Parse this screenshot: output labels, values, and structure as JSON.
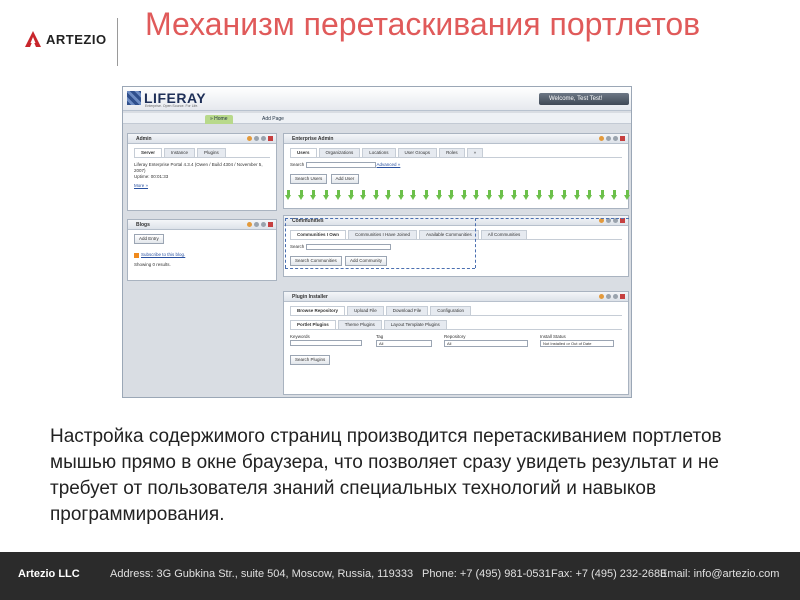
{
  "logo": {
    "text": "ARTEZIO"
  },
  "title": "Механизм перетаскивания портлетов",
  "screenshot": {
    "brand": "LIFERAY",
    "brand_sub": "Enterprise. Open Source. For Life.",
    "welcome": "Welcome, Test Test!",
    "nav": {
      "home": "» Home",
      "add_page": "Add Page"
    },
    "admin_portlet": {
      "title": "Admin",
      "tabs": [
        "Server",
        "Instance",
        "Plugins"
      ],
      "info_1": "Liferay Enterprise Portal 4.3.4 (Owen / Build 4304 / November 5, 2007)",
      "info_2": "Uptime: 00:01:33",
      "link": "More »"
    },
    "blogs_portlet": {
      "title": "Blogs",
      "button": "Add Entry",
      "link": "Subscribe to this blog.",
      "status": "Showing 0 results."
    },
    "enterprise_portlet": {
      "title": "Enterprise Admin",
      "tabs": [
        "Users",
        "Organizations",
        "Locations",
        "User Groups",
        "Roles",
        "»"
      ],
      "search_label": "Search",
      "advanced": "Advanced »",
      "buttons": [
        "Search Users",
        "Add User"
      ]
    },
    "communities_portlet": {
      "title": "Communities",
      "tabs": [
        "Communities I Own",
        "Communities I Have Joined",
        "Available Communities",
        "All Communities"
      ],
      "search_label": "Search",
      "buttons": [
        "Search Communities",
        "Add Community"
      ]
    },
    "plugin_portlet": {
      "title": "Plugin Installer",
      "tabs": [
        "Browse Repository",
        "Upload File",
        "Download File",
        "Configuration"
      ],
      "subtabs": [
        "Portlet Plugins",
        "Theme Plugins",
        "Layout Template Plugins"
      ],
      "labels": [
        "Keywords",
        "Tag",
        "Repository",
        "Install Status"
      ],
      "selects": [
        "All",
        "All",
        "Not Installed or Out of Date"
      ],
      "button": "Search Plugins"
    }
  },
  "description": "Настройка содержимого страниц производится перетаскиванием портлетов мышью прямо в окне браузера, что позволяет сразу увидеть результат и не требует от пользователя знаний специальных технологий и навыков программирования.",
  "footer": {
    "company": "Artezio LLC",
    "address": "Address: 3G Gubkina Str., suite 504, Moscow, Russia, 119333",
    "phone": "Phone: +7 (495) 981-0531",
    "fax": "Fax: +7 (495) 232-2683",
    "email": "Email: info@artezio.com"
  },
  "colors": {
    "title": "#e05a5a",
    "footer_bg": "#2b2b2b",
    "logo_red": "#c8262c"
  }
}
